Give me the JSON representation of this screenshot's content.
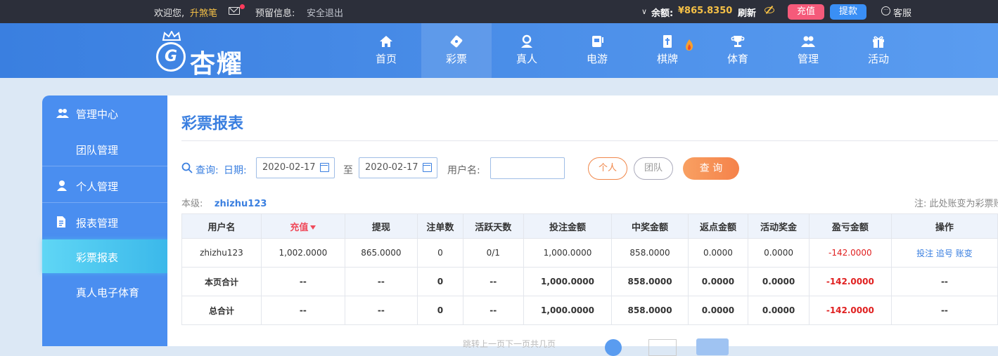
{
  "topbar": {
    "welcome": "欢迎您,",
    "username": "升煞笔",
    "reserve_label": "预留信息:",
    "logout": "安全退出",
    "balance_label": "余额:",
    "balance_value": "¥865.8350",
    "refresh": "刷新",
    "recharge": "充值",
    "withdraw": "提款",
    "service": "客服"
  },
  "header": {
    "logo_text": "杏耀",
    "nav": [
      {
        "label": "首页",
        "icon": "home-icon"
      },
      {
        "label": "彩票",
        "icon": "ticket-icon"
      },
      {
        "label": "真人",
        "icon": "person-icon"
      },
      {
        "label": "电游",
        "icon": "slot-icon"
      },
      {
        "label": "棋牌",
        "icon": "mahjong-icon"
      },
      {
        "label": "体育",
        "icon": "trophy-icon"
      },
      {
        "label": "管理",
        "icon": "users-icon"
      },
      {
        "label": "活动",
        "icon": "gift-icon"
      }
    ]
  },
  "sidebar": {
    "items": [
      {
        "label": "管理中心"
      },
      {
        "label": "团队管理"
      },
      {
        "label": "个人管理"
      },
      {
        "label": "报表管理"
      },
      {
        "label": "彩票报表"
      },
      {
        "label": "真人电子体育"
      }
    ]
  },
  "main": {
    "title": "彩票报表",
    "query_label": "查询:",
    "date_label": "日期:",
    "date_from": "2020-02-17",
    "to_label": "至",
    "date_to": "2020-02-17",
    "username_label": "用户名:",
    "username_value": "",
    "btn_person": "个人",
    "btn_team": "团队",
    "btn_query": "查 询",
    "level_label": "本级:",
    "level_name": "zhizhu123",
    "note": "注: 此处账变为彩票账",
    "pager_text": "跳转上一页下一页共几页"
  },
  "table": {
    "headers": [
      "用户名",
      "充值",
      "提现",
      "注单数",
      "活跃天数",
      "投注金额",
      "中奖金额",
      "返点金额",
      "活动奖金",
      "盈亏金额",
      "操作"
    ],
    "rows": [
      [
        "zhizhu123",
        "1,002.0000",
        "865.0000",
        "0",
        "0/1",
        "1,000.0000",
        "858.0000",
        "0.0000",
        "0.0000",
        "-142.0000",
        "投注 追号 账变"
      ],
      [
        "本页合计",
        "--",
        "--",
        "0",
        "--",
        "1,000.0000",
        "858.0000",
        "0.0000",
        "0.0000",
        "-142.0000",
        "--"
      ],
      [
        "总合计",
        "--",
        "--",
        "0",
        "--",
        "1,000.0000",
        "858.0000",
        "0.0000",
        "0.0000",
        "-142.0000",
        "--"
      ]
    ]
  },
  "colors": {
    "primary": "#3a7fe0",
    "accent": "#f5824a",
    "negative": "#e02020",
    "gold": "#f5c046"
  }
}
